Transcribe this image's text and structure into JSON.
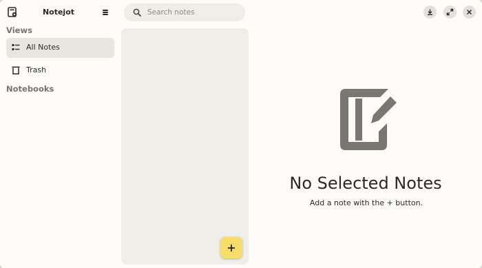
{
  "app": {
    "title": "Notejot"
  },
  "sidebar": {
    "views_title": "Views",
    "items": [
      {
        "label": "All Notes",
        "icon": "list-icon",
        "active": true
      },
      {
        "label": "Trash",
        "icon": "trash-icon",
        "active": false
      }
    ],
    "notebooks_title": "Notebooks"
  },
  "search": {
    "placeholder": "Search notes",
    "value": ""
  },
  "add_button": {
    "label": "+"
  },
  "empty_state": {
    "title": "No Selected Notes",
    "subtitle": "Add a note with the + button."
  },
  "colors": {
    "background": "#fcfbf7",
    "accent_add": "#f6dd6a",
    "active_item": "#e8e6e1",
    "notes_column": "#f0eee9",
    "empty_icon": "#7a7772"
  }
}
